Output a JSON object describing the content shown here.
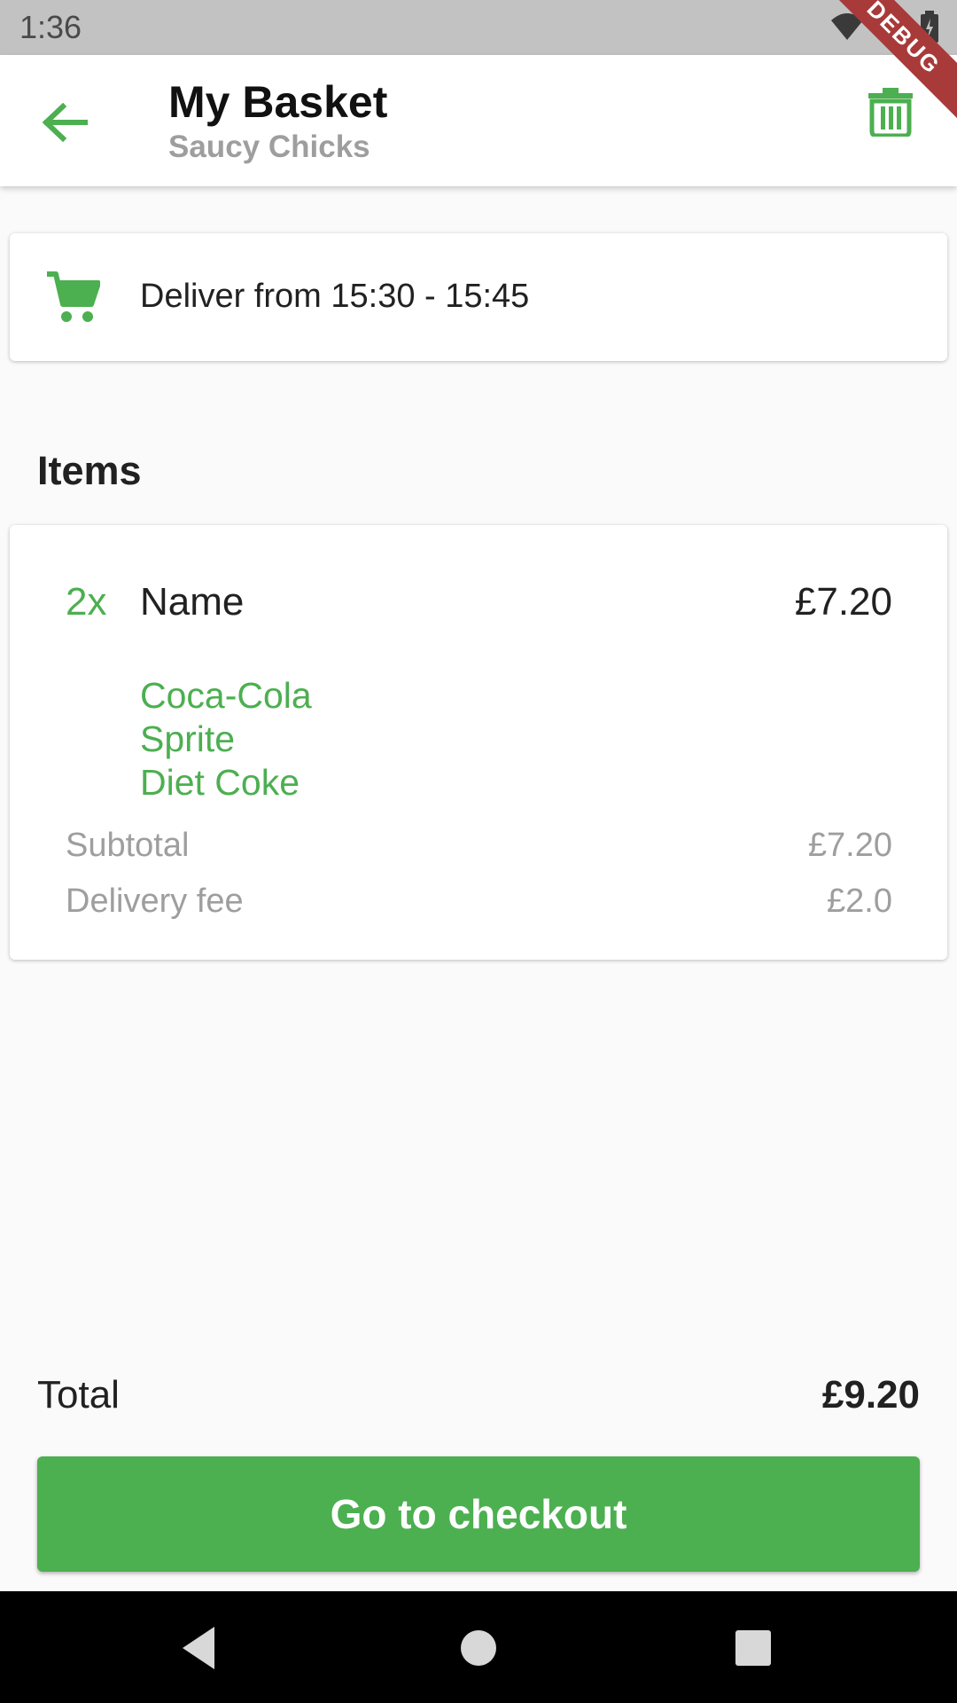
{
  "status_bar": {
    "time": "1:36",
    "icons": [
      "wifi-icon",
      "signal-icon",
      "battery-icon"
    ]
  },
  "debug_banner": "DEBUG",
  "app_bar": {
    "title": "My Basket",
    "subtitle": "Saucy Chicks",
    "back_icon": "arrow-back-icon",
    "delete_icon": "trash-icon"
  },
  "delivery": {
    "icon": "cart-icon",
    "text": "Deliver from 15:30 - 15:45"
  },
  "items_heading": "Items",
  "items": [
    {
      "quantity": "2x",
      "name": "Name",
      "price": "£7.20",
      "options": [
        "Coca-Cola",
        "Sprite",
        "Diet Coke"
      ]
    }
  ],
  "summary": {
    "subtotal_label": "Subtotal",
    "subtotal_value": "£7.20",
    "delivery_fee_label": "Delivery fee",
    "delivery_fee_value": "£2.0"
  },
  "total": {
    "label": "Total",
    "value": "£9.20"
  },
  "checkout_button": "Go to checkout",
  "colors": {
    "accent": "#4caf50",
    "muted": "#9e9e9e",
    "debug": "#a83a3a"
  }
}
